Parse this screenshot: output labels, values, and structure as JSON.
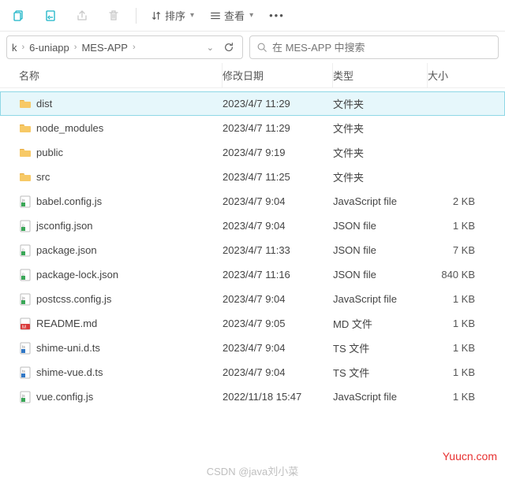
{
  "toolbar": {
    "sort_label": "排序",
    "view_label": "查看"
  },
  "breadcrumb": {
    "items": [
      "k",
      "6-uniapp",
      "MES-APP"
    ]
  },
  "search": {
    "placeholder": "在 MES-APP 中搜索"
  },
  "columns": {
    "name": "名称",
    "date": "修改日期",
    "type": "类型",
    "size": "大小"
  },
  "files": [
    {
      "icon": "folder",
      "name": "dist",
      "date": "2023/4/7 11:29",
      "type": "文件夹",
      "size": "",
      "selected": true
    },
    {
      "icon": "folder",
      "name": "node_modules",
      "date": "2023/4/7 11:29",
      "type": "文件夹",
      "size": ""
    },
    {
      "icon": "folder",
      "name": "public",
      "date": "2023/4/7 9:19",
      "type": "文件夹",
      "size": ""
    },
    {
      "icon": "folder",
      "name": "src",
      "date": "2023/4/7 11:25",
      "type": "文件夹",
      "size": ""
    },
    {
      "icon": "js",
      "name": "babel.config.js",
      "date": "2023/4/7 9:04",
      "type": "JavaScript file",
      "size": "2 KB"
    },
    {
      "icon": "json",
      "name": "jsconfig.json",
      "date": "2023/4/7 9:04",
      "type": "JSON file",
      "size": "1 KB"
    },
    {
      "icon": "json",
      "name": "package.json",
      "date": "2023/4/7 11:33",
      "type": "JSON file",
      "size": "7 KB"
    },
    {
      "icon": "json",
      "name": "package-lock.json",
      "date": "2023/4/7 11:16",
      "type": "JSON file",
      "size": "840 KB"
    },
    {
      "icon": "js",
      "name": "postcss.config.js",
      "date": "2023/4/7 9:04",
      "type": "JavaScript file",
      "size": "1 KB"
    },
    {
      "icon": "md",
      "name": "README.md",
      "date": "2023/4/7 9:05",
      "type": "MD 文件",
      "size": "1 KB"
    },
    {
      "icon": "ts",
      "name": "shime-uni.d.ts",
      "date": "2023/4/7 9:04",
      "type": "TS 文件",
      "size": "1 KB"
    },
    {
      "icon": "ts",
      "name": "shime-vue.d.ts",
      "date": "2023/4/7 9:04",
      "type": "TS 文件",
      "size": "1 KB"
    },
    {
      "icon": "js",
      "name": "vue.config.js",
      "date": "2022/11/18 15:47",
      "type": "JavaScript file",
      "size": "1 KB"
    }
  ],
  "watermark": {
    "site": "Yuucn.com",
    "author": "CSDN @java刘小菜"
  }
}
